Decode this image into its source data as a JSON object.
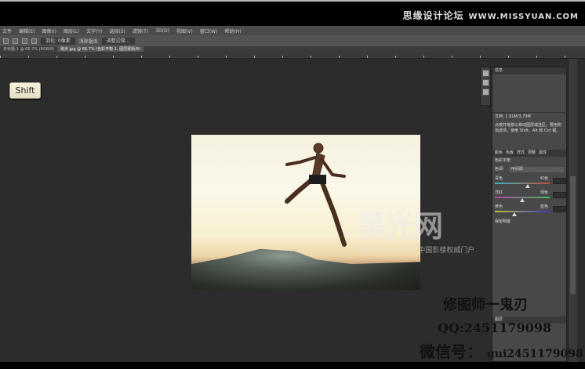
{
  "watermark_top": {
    "cn": "思缘设计论坛",
    "url": "WWW.MISSYUAN.COM"
  },
  "menu": [
    "文件",
    "编辑(E)",
    "图像(I)",
    "图层(L)",
    "文字(Y)",
    "选择(S)",
    "滤镜(T)",
    "3D(D)",
    "视图(V)",
    "窗口(W)",
    "帮助(H)"
  ],
  "options": {
    "feather": "羽化: 0像素",
    "antialias": "消除锯齿",
    "refine": "调整边缘..."
  },
  "tabs": [
    "未标题-1 @ 66.7% (RGB/8)",
    "跑步.jpg @ 66.7% (色彩平衡 1, 图层蒙版/8)"
  ],
  "key_overlay": "Shift",
  "panels": {
    "info_title": "信息",
    "info_desc_title": "文档: 1.91M/3.79M",
    "info_desc": "点按并拖移以移动图层或选区。要用附加选项，使用 Shift、Alt 和 Ctrl 键。",
    "props_tabs": [
      "颜色",
      "色板",
      "样式",
      "调整",
      "属性"
    ],
    "props_title": "色彩平衡",
    "tone_label": "色调:",
    "tone_value": "中间调",
    "sliders": [
      {
        "left": "青色",
        "right": "红色",
        "value": 0.6,
        "colors": [
          "#3bb0c0",
          "#c0503b"
        ]
      },
      {
        "left": "洋红",
        "right": "绿色",
        "value": 0.5,
        "colors": [
          "#c03bb0",
          "#3bc05a"
        ]
      },
      {
        "left": "黄色",
        "right": "蓝色",
        "value": 0.35,
        "colors": [
          "#c0c03b",
          "#3b3bc0"
        ]
      }
    ],
    "preserve": "保留明度",
    "layers_title": "图层"
  },
  "watermark_logo": {
    "logo": "黑光网",
    "sub": "HEIGUANG.COM 中国影楼权威门户"
  },
  "credits": {
    "author": "修图师一鬼刃",
    "qq": "QQ:2451179098",
    "wx_label": "微信号：",
    "wx": "gui2451179098"
  }
}
